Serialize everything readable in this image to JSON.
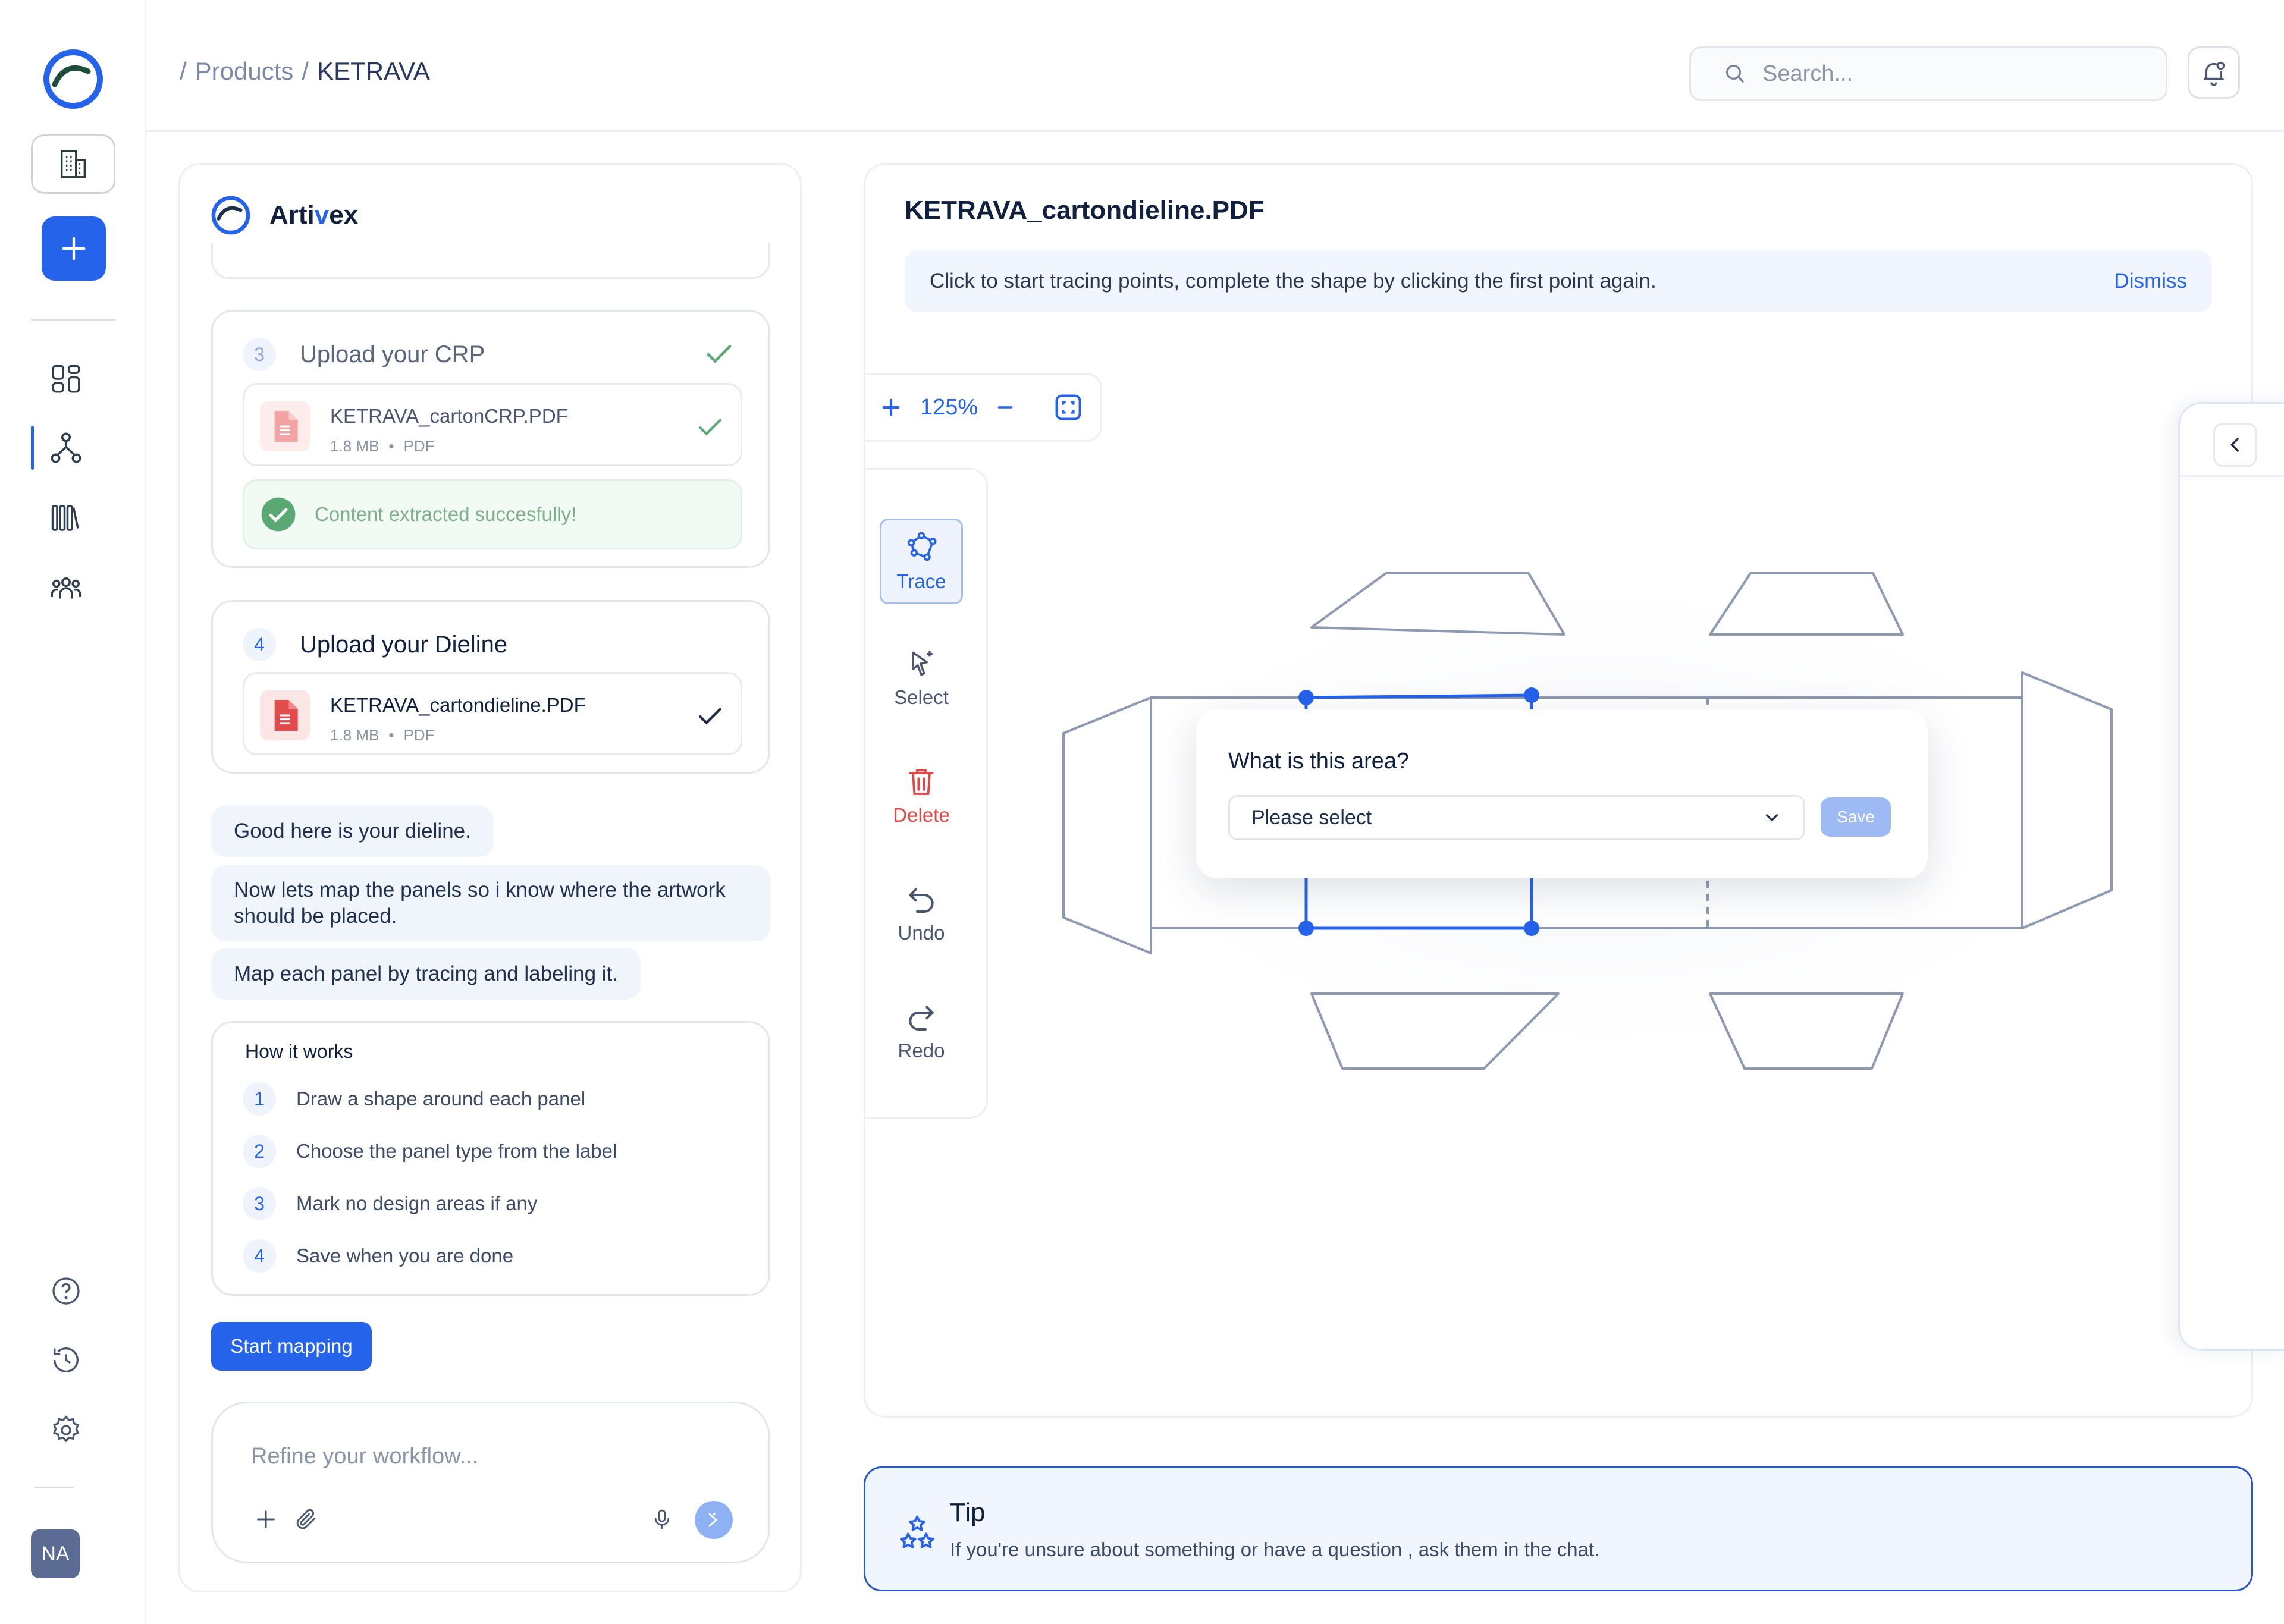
{
  "breadcrumb": {
    "sep1": "/",
    "products": "Products",
    "sep2": "/",
    "current": "KETRAVA"
  },
  "search": {
    "placeholder": "Search..."
  },
  "sidebar": {
    "avatar": "NA"
  },
  "chat": {
    "brand": {
      "pre": "Arti",
      "accent": "v",
      "post": "ex"
    },
    "step3": {
      "number": "3",
      "title": "Upload your CRP",
      "file": {
        "name": "KETRAVA_cartonCRP.PDF",
        "size": "1.8 MB",
        "dot": "•",
        "type": "PDF"
      },
      "success": "Content extracted succesfully!"
    },
    "step4": {
      "number": "4",
      "title": "Upload your Dieline",
      "file": {
        "name": "KETRAVA_cartondieline.PDF",
        "size": "1.8 MB",
        "dot": "•",
        "type": "PDF"
      }
    },
    "messages": [
      "Good here is your dieline.",
      "Now lets map the panels so i know where the artwork should be placed.",
      "Map each panel by tracing and labeling it."
    ],
    "how_it_works": {
      "title": "How it works",
      "steps": [
        {
          "n": "1",
          "text": "Draw a shape around each panel"
        },
        {
          "n": "2",
          "text": "Choose the panel type from the label"
        },
        {
          "n": "3",
          "text": "Mark no design areas if any"
        },
        {
          "n": "4",
          "text": "Save when you are done"
        }
      ]
    },
    "start_button": "Start mapping",
    "composer_placeholder": "Refine your workflow..."
  },
  "canvas": {
    "file_title": "KETRAVA_cartondieline.PDF",
    "hint": "Click to start tracing points, complete the shape by clicking the first point again.",
    "dismiss": "Dismiss",
    "zoom": "125%",
    "tools": [
      "Trace",
      "Select",
      "Delete",
      "Undo",
      "Redo"
    ],
    "popover": {
      "title": "What is this area?",
      "select_value": "Please select",
      "save": "Save"
    }
  },
  "tip": {
    "title": "Tip",
    "text": "If you're unsure about something or have a question , ask them in the chat."
  },
  "colors": {
    "accent": "#2563eb",
    "success": "#5aa874",
    "danger": "#e04646"
  }
}
